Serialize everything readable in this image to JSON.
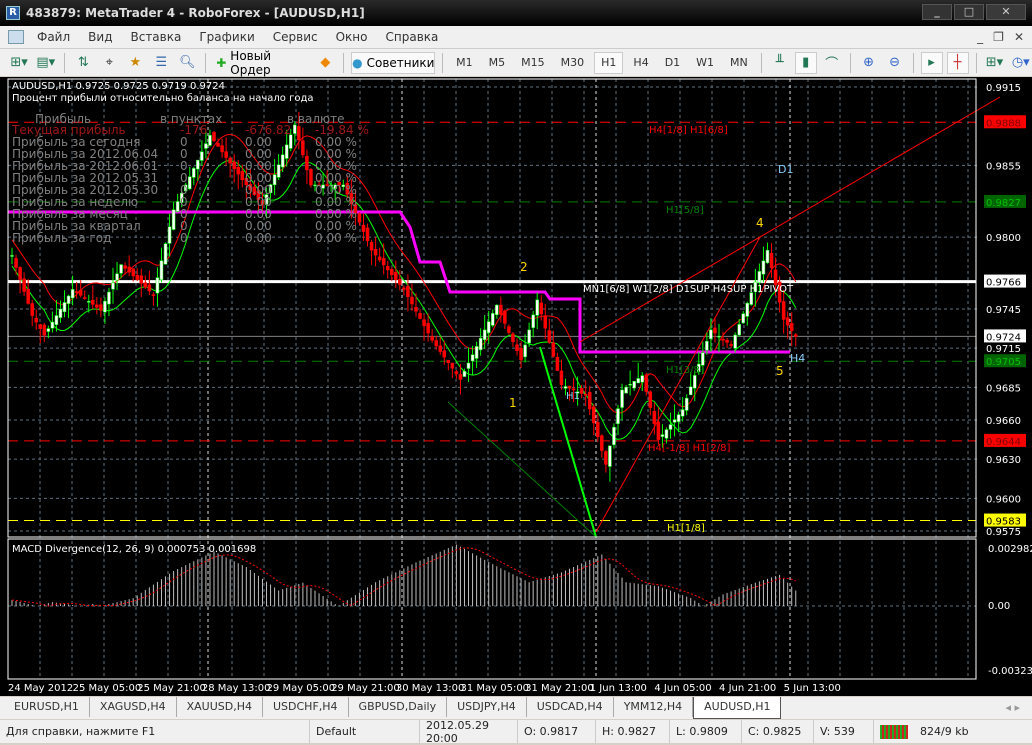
{
  "window": {
    "title": "483879: MetaTrader 4 - RoboForex - [AUDUSD,H1]",
    "min": "_",
    "max": "□",
    "close": "✕"
  },
  "menu": [
    "Файл",
    "Вид",
    "Вставка",
    "Графики",
    "Сервис",
    "Окно",
    "Справка"
  ],
  "child_buttons": [
    "_",
    "❐",
    "✕"
  ],
  "toolbar": {
    "new_order": "Новый Ордер",
    "experts": "Советники",
    "timeframes": [
      "M1",
      "M5",
      "M15",
      "M30",
      "H1",
      "H4",
      "D1",
      "W1",
      "MN"
    ],
    "active_tf": "H1"
  },
  "chart": {
    "header": "AUDUSD,H1  0.9725 0.9725 0.9719 0.9724",
    "subtitle": "Процент прибыли относительно баланса на начало года",
    "table_headers": [
      "Прибыль",
      "в пунктах",
      "в валюте"
    ],
    "table_rows": [
      [
        "Текущая прибыль",
        "-176",
        "-676.82",
        "-19.84 %"
      ],
      [
        "Прибыль за сегодня",
        "0",
        "0.00",
        "0.00 %"
      ],
      [
        "Прибыль за 2012.06.04",
        "0",
        "0.00",
        "0.00 %"
      ],
      [
        "Прибыль за 2012.06.01",
        "0",
        "0.00",
        "0.00 %"
      ],
      [
        "Прибыль за 2012.05.31",
        "0",
        "0.00",
        "0.00 %"
      ],
      [
        "Прибыль за 2012.05.30",
        "0",
        "0.00",
        "0.00 %"
      ],
      [
        "Прибыль за неделю",
        "0",
        "0.00",
        "0.00 %"
      ],
      [
        "Прибыль за месяц",
        "0",
        "0.00",
        "0.00 %"
      ],
      [
        "Прибыль за квартал",
        "0",
        "0.00",
        "0.00 %"
      ],
      [
        "Прибыль за год",
        "0",
        "0.00",
        "0.00 %"
      ]
    ],
    "annotations": {
      "w1": "1",
      "w2": "2",
      "w4": "4",
      "w5": "5",
      "d1": "D1",
      "h4": "H4",
      "h1": "H1",
      "lvl_9888": "H4[1/8] H1[6/8]",
      "lvl_9827": "H1[5/8]",
      "lvl_9766": "MN1[6/8] W1[2/8] D1SUP H4SUP H1PIVOT",
      "lvl_9705": "H1[3/8]",
      "lvl_9644": "H4[-1/8] H1[2/8]",
      "lvl_9583": "H1[1/8]"
    },
    "price_labels": [
      "0.9915",
      "0.9855",
      "0.9800",
      "0.9745",
      "0.9715",
      "0.9685",
      "0.9660",
      "0.9630",
      "0.9600",
      "0.9575"
    ],
    "marked_levels": [
      {
        "price": "0.9888",
        "bg": "#ff0000",
        "fg": "#800000",
        "line": "#ff0000"
      },
      {
        "price": "0.9827",
        "bg": "#006400",
        "fg": "#00c000",
        "line": "#008000"
      },
      {
        "price": "0.9766",
        "bg": "#ffffff",
        "fg": "#000000",
        "line": "#ffffff"
      },
      {
        "price": "0.9724",
        "bg": "#ffffff",
        "fg": "#000000",
        "line": "#808080"
      },
      {
        "price": "0.9705",
        "bg": "#006400",
        "fg": "#00c000",
        "line": "#008000"
      },
      {
        "price": "0.9644",
        "bg": "#ff0000",
        "fg": "#800000",
        "line": "#ff0000"
      },
      {
        "price": "0.9583",
        "bg": "#ffff00",
        "fg": "#000000",
        "line": "#ffff00"
      }
    ],
    "price_range": [
      0.9575,
      0.9915
    ],
    "time_labels": [
      "24 May 2012",
      "25 May 05:00",
      "25 May 21:00",
      "28 May 13:00",
      "29 May 05:00",
      "29 May 21:00",
      "30 May 13:00",
      "31 May 05:00",
      "31 May 21:00",
      "1 Jun 13:00",
      "4 Jun 05:00",
      "4 Jun 21:00",
      "5 Jun 13:00"
    ],
    "price_path": [
      [
        0,
        0.9786
      ],
      [
        5,
        0.974
      ],
      [
        8,
        0.9725
      ],
      [
        15,
        0.976
      ],
      [
        22,
        0.9744
      ],
      [
        27,
        0.9779
      ],
      [
        35,
        0.9756
      ],
      [
        40,
        0.9821
      ],
      [
        49,
        0.9878
      ],
      [
        57,
        0.9844
      ],
      [
        62,
        0.9825
      ],
      [
        70,
        0.9886
      ],
      [
        74,
        0.984
      ],
      [
        82,
        0.984
      ],
      [
        89,
        0.979
      ],
      [
        97,
        0.976
      ],
      [
        104,
        0.9721
      ],
      [
        111,
        0.9691
      ],
      [
        120,
        0.9748
      ],
      [
        126,
        0.9706
      ],
      [
        130,
        0.9752
      ],
      [
        136,
        0.9687
      ],
      [
        142,
        0.9679
      ],
      [
        147,
        0.9626
      ],
      [
        151,
        0.9683
      ],
      [
        156,
        0.9694
      ],
      [
        160,
        0.9645
      ],
      [
        166,
        0.9668
      ],
      [
        173,
        0.9729
      ],
      [
        178,
        0.9717
      ],
      [
        187,
        0.979
      ],
      [
        191,
        0.9737
      ],
      [
        194,
        0.9724
      ]
    ],
    "macd": {
      "title": "MACD Divergence(12, 26, 9) 0.000753 0.001698",
      "max_label": "0.002982",
      "zero_label": "0.00",
      "min_label": "-0.00323",
      "range": [
        -0.00323,
        0.002982
      ],
      "hist_path": [
        [
          0,
          -0.0003
        ],
        [
          10,
          0.0002
        ],
        [
          20,
          -0.0001
        ],
        [
          30,
          0.0004
        ],
        [
          40,
          0.0018
        ],
        [
          50,
          0.0028
        ],
        [
          58,
          0.002
        ],
        [
          66,
          0.0008
        ],
        [
          72,
          0.0012
        ],
        [
          80,
          0.0001
        ],
        [
          90,
          -0.0012
        ],
        [
          100,
          -0.0022
        ],
        [
          110,
          -0.0031
        ],
        [
          120,
          -0.002
        ],
        [
          128,
          -0.0012
        ],
        [
          136,
          -0.0017
        ],
        [
          146,
          -0.0026
        ],
        [
          152,
          -0.0012
        ],
        [
          160,
          -0.001
        ],
        [
          168,
          -0.0004
        ],
        [
          176,
          0.0006
        ],
        [
          184,
          0.0012
        ],
        [
          190,
          0.0016
        ],
        [
          194,
          0.0008
        ]
      ]
    }
  },
  "tabs": [
    "EURUSD,H1",
    "XAGUSD,H4",
    "XAUUSD,H4",
    "USDCHF,H4",
    "GBPUSD,Daily",
    "USDJPY,H4",
    "USDCAD,H4",
    "YMM12,H4",
    "AUDUSD,H1"
  ],
  "active_tab": "AUDUSD,H1",
  "status": {
    "help": "Для справки, нажмите F1",
    "profile": "Default",
    "datetime": "2012.05.29 20:00",
    "open": "O: 0.9817",
    "high": "H: 0.9827",
    "low": "L: 0.9809",
    "close": "C: 0.9825",
    "volume": "V: 539",
    "traffic": "824/9 kb"
  }
}
